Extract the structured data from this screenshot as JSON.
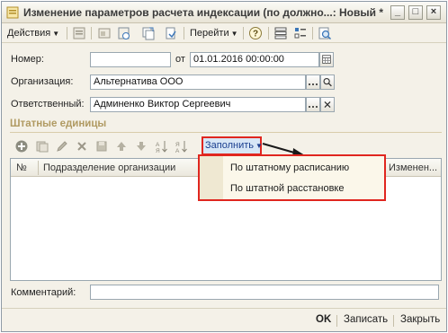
{
  "window": {
    "title": "Изменение параметров расчета индексации (по должно...: Новый *",
    "minimize": "_",
    "maximize": "□",
    "close": "×"
  },
  "toolbar": {
    "actions_label": "Действия",
    "goto_label": "Перейти",
    "help_label": "?"
  },
  "form": {
    "number_label": "Номер:",
    "number_value": "",
    "date_from_label": "от",
    "date_value": "01.01.2016 00:00:00",
    "org_label": "Организация:",
    "org_value": "Альтернатива ООО",
    "responsible_label": "Ответственный:",
    "responsible_value": "Админенко Виктор Сергеевич",
    "comment_label": "Комментарий:",
    "comment_value": ""
  },
  "section": {
    "title": "Штатные единицы",
    "fill_label": "Заполнить"
  },
  "grid": {
    "columns": [
      "№",
      "Подразделение организации",
      "Изменен..."
    ],
    "rows": []
  },
  "dropdown": {
    "items": [
      "По штатному расписанию",
      "По штатной расстановке"
    ]
  },
  "footer": {
    "ok_label": "OK",
    "save_label": "Записать",
    "close_label": "Закрыть"
  },
  "colors": {
    "highlight_border": "#e0261f",
    "section_title": "#b09a62",
    "fill_button_bg": "#d7e6f6"
  }
}
